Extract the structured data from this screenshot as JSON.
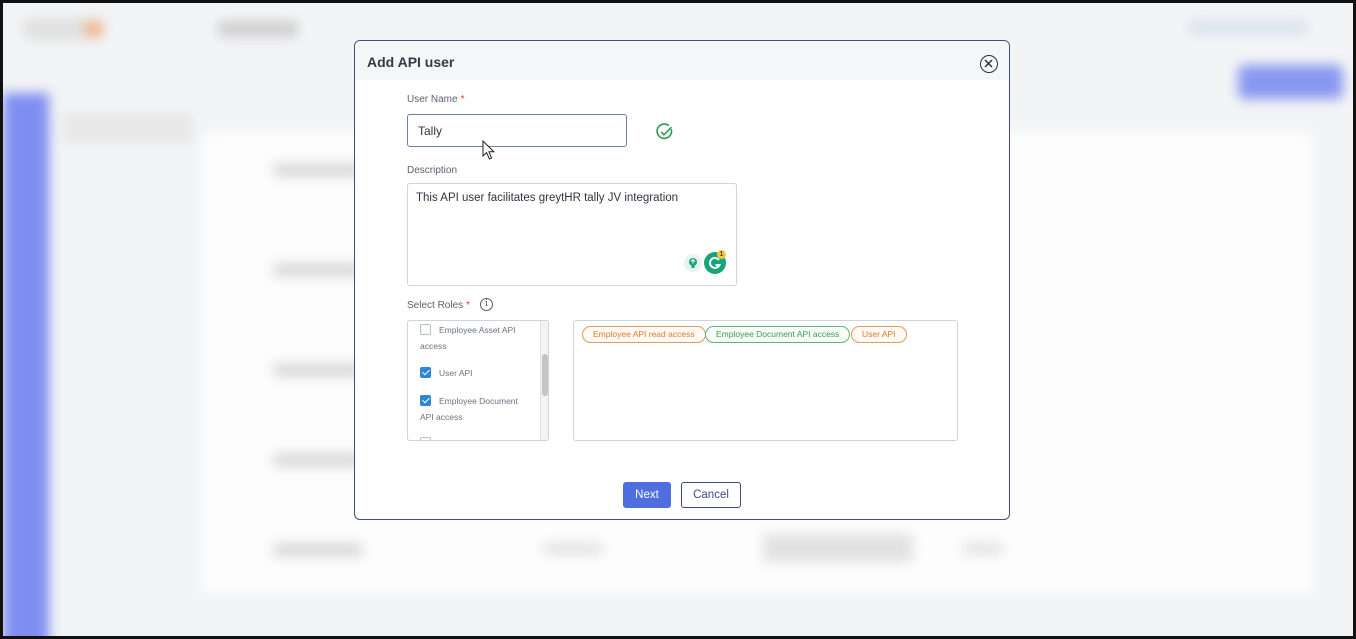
{
  "modal": {
    "title": "Add API user",
    "close_icon": "close-circle-icon"
  },
  "form": {
    "username_label": "User Name",
    "username_value": "Tally",
    "required_mark": "*",
    "username_status_icon": "check-circle-icon",
    "description_label": "Description",
    "description_value": "This API user facilitates greytHR tally JV integration",
    "grammarly_badge_count": "1",
    "roles_label": "Select Roles",
    "roles_info_icon": "info-icon",
    "roles_info_glyph": "i"
  },
  "roles_list": [
    {
      "label": "Employee Asset API access",
      "checked": false
    },
    {
      "label": "User API",
      "checked": true
    },
    {
      "label": "Employee Document API access",
      "checked": true
    }
  ],
  "selected_roles": [
    {
      "label": "Employee API read access",
      "color": "#e07a2c"
    },
    {
      "label": "Employee Document API access",
      "color": "#3b9a5a"
    },
    {
      "label": "User API",
      "color": "#e07a2c"
    }
  ],
  "buttons": {
    "next": "Next",
    "cancel": "Cancel"
  },
  "colors": {
    "primary": "#4f6fe0",
    "success": "#2e9c4f",
    "required": "#e53935"
  }
}
